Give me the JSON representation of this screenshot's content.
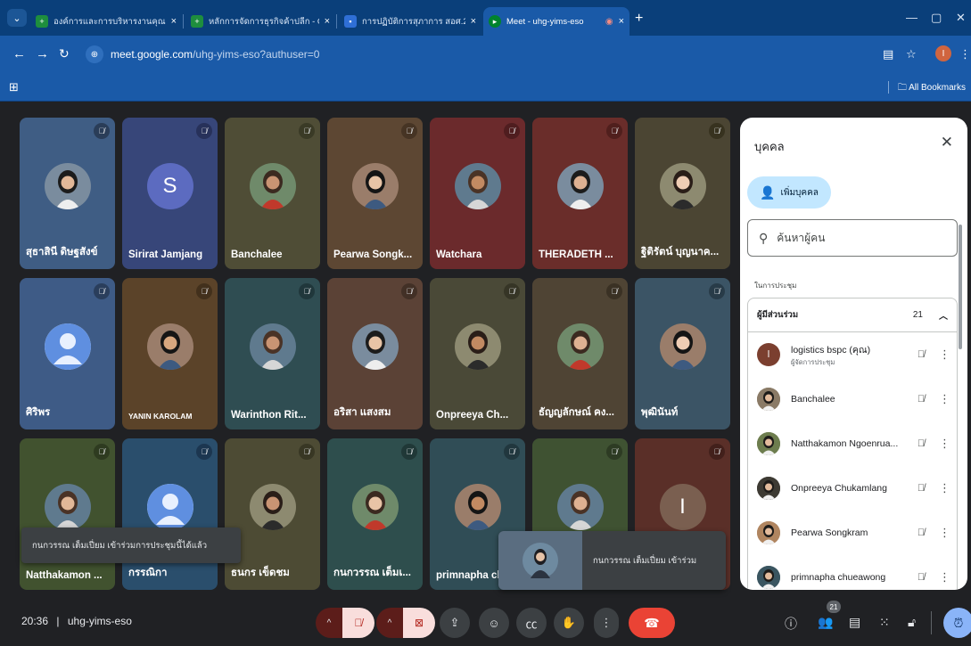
{
  "browser": {
    "tabs": [
      {
        "title": "องค์การและการบริหารงานคุณภาพ -",
        "icon": "sheets-icon",
        "active": false
      },
      {
        "title": "หลักการจัดการธุรกิจค้าปลีก - Goog",
        "icon": "sheets-icon",
        "active": false
      },
      {
        "title": "การปฏิบัติการสุภาการ สอศ.2",
        "icon": "classroom-icon",
        "active": false
      },
      {
        "title": "Meet - uhg-yims-eso",
        "icon": "meet-icon",
        "active": true
      }
    ],
    "close_glyph": "×",
    "new_tab_glyph": "+",
    "url_domain": "meet.google.com",
    "url_path": "/uhg-yims-eso?authuser=0",
    "all_bookmarks": "All Bookmarks",
    "profile_initial": "I"
  },
  "meeting": {
    "tiles": [
      {
        "name": "สุธาสินี ดิษฐสังข์",
        "bg": "#3f5d84",
        "avatar": "photo",
        "mic_bg": "#2a3d58"
      },
      {
        "name": "Sirirat Jamjang",
        "bg": "#374679",
        "avatar": "letter",
        "letter": "S",
        "letter_bg": "#5c6bc0",
        "mic_bg": "#27315a"
      },
      {
        "name": "Banchalee",
        "bg": "#4f4d36",
        "avatar": "photo",
        "mic_bg": "#3a3a26"
      },
      {
        "name": "Pearwa Songk...",
        "bg": "#5d4733",
        "avatar": "photo",
        "mic_bg": "#463424"
      },
      {
        "name": "Watchara",
        "bg": "#6b2a2c",
        "avatar": "photo",
        "mic_bg": "#4f1d1f"
      },
      {
        "name": "THERADETH ...",
        "bg": "#6a2d2a",
        "avatar": "photo",
        "mic_bg": "#501f1d"
      },
      {
        "name": "ฐิติรัตน์ บุญนาค...",
        "bg": "#4b4533",
        "avatar": "photo",
        "mic_bg": "#37321f"
      },
      {
        "name": "ศิริพร",
        "bg": "#3e5b86",
        "avatar": "person",
        "mic_bg": "#2a3e5c"
      },
      {
        "name": "YANIN KAROLAM",
        "bg": "#5b4329",
        "avatar": "photo",
        "mic_bg": "#42301c",
        "small": true
      },
      {
        "name": "Warinthon Rit...",
        "bg": "#2f4d52",
        "avatar": "photo",
        "mic_bg": "#20373b"
      },
      {
        "name": "อริสา แสงสม",
        "bg": "#5b4236",
        "avatar": "photo",
        "mic_bg": "#423026"
      },
      {
        "name": "Onpreeya Ch...",
        "bg": "#4a4937",
        "avatar": "photo",
        "mic_bg": "#363526"
      },
      {
        "name": "ธัญญลักษณ์ คง...",
        "bg": "#4f4434",
        "avatar": "photo",
        "mic_bg": "#3a3124"
      },
      {
        "name": "พุฒินันท์",
        "bg": "#3b5465",
        "avatar": "photo",
        "mic_bg": "#283b48"
      },
      {
        "name": "Natthakamon ...",
        "bg": "#41522f",
        "avatar": "photo",
        "mic_bg": "#2e3b20"
      },
      {
        "name": "กรรณิกา",
        "bg": "#2a4e6c",
        "avatar": "person",
        "mic_bg": "#1c3650"
      },
      {
        "name": "ธนกร เข็ดชม",
        "bg": "#4d4b34",
        "avatar": "photo",
        "mic_bg": "#383724"
      },
      {
        "name": "กนกวรรณ เต็มเ...",
        "bg": "#2e4e4d",
        "avatar": "photo",
        "mic_bg": "#203837"
      },
      {
        "name": "primnapha ch",
        "bg": "#304d56",
        "avatar": "photo",
        "mic_bg": "#21373e"
      },
      {
        "name": "",
        "bg": "#3f5232",
        "avatar": "photo",
        "mic_bg": "#2d3b23"
      },
      {
        "name": "",
        "bg": "#5a2f28",
        "avatar": "letter",
        "letter": "I",
        "letter_bg": "#7a5f50",
        "mic_bg": "#42201b"
      }
    ],
    "toast": "กนกวรรณ เต็มเปี่ยม เข้าร่วมการประชุมนี้ได้แล้ว",
    "join_popup": "กนกวรรณ เต็มเปี่ยม เข้าร่วม",
    "time": "20:36",
    "code": "uhg-yims-eso",
    "people_badge": "21"
  },
  "panel": {
    "title": "บุคคล",
    "add_label": "เพิ่มบุคคล",
    "search_placeholder": "ค้นหาผู้คน",
    "section": "ในการประชุม",
    "group_label": "ผู้มีส่วนร่วม",
    "group_count": "21",
    "participants": [
      {
        "name": "logistics bspc (คุณ)",
        "sub": "ผู้จัดการประชุม",
        "avatar": "letter",
        "letter": "l",
        "color": "#7b3f2f"
      },
      {
        "name": "Banchalee",
        "sub": "",
        "avatar": "photo",
        "color": "#8a7a66"
      },
      {
        "name": "Natthakamon Ngoenrua...",
        "sub": "",
        "avatar": "photo",
        "color": "#6d7d4e"
      },
      {
        "name": "Onpreeya Chukamlang",
        "sub": "",
        "avatar": "photo",
        "color": "#3d3a33"
      },
      {
        "name": "Pearwa Songkram",
        "sub": "",
        "avatar": "photo",
        "color": "#b08560"
      },
      {
        "name": "primnapha chueawong",
        "sub": "",
        "avatar": "photo",
        "color": "#3a5560"
      }
    ]
  },
  "icons": {
    "mic_off": "mic-off-icon",
    "cam_off": "camera-off-icon",
    "present": "present-icon",
    "emoji": "emoji-icon",
    "captions": "captions-icon",
    "hand": "raise-hand-icon",
    "more": "more-options-icon",
    "end_call": "end-call-icon",
    "info": "info-icon",
    "people": "people-icon",
    "chat": "chat-icon",
    "activities": "activities-icon",
    "host": "host-controls-icon"
  }
}
